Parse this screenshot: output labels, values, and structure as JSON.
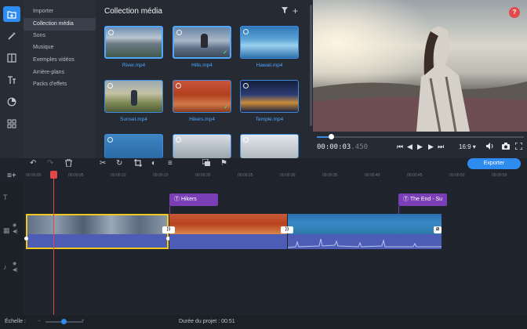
{
  "nav": {
    "items": [
      "Importer",
      "Collection média",
      "Sons",
      "Musique",
      "Exemples vidéos",
      "Arrière-plans",
      "Packs d'effets"
    ]
  },
  "media": {
    "title": "Collection média",
    "items": [
      {
        "label": "River.mp4",
        "selected": true,
        "checked": false
      },
      {
        "label": "Hills.mp4",
        "selected": true,
        "checked": true
      },
      {
        "label": "Hawaii.mp4",
        "selected": false,
        "checked": false
      },
      {
        "label": "Sunset.mp4",
        "selected": false,
        "checked": false
      },
      {
        "label": "Hikers.mp4",
        "selected": false,
        "checked": true
      },
      {
        "label": "Temple.mp4",
        "selected": false,
        "checked": false
      },
      {
        "label": "",
        "selected": false,
        "checked": false
      },
      {
        "label": "",
        "selected": false,
        "checked": false
      },
      {
        "label": "",
        "selected": false,
        "checked": false
      }
    ]
  },
  "player": {
    "timecode_main": "00:00:03",
    "timecode_ms": ".450",
    "aspect_ratio": "16:9",
    "progress": 0.07
  },
  "toolbar": {
    "export_label": "Exporter"
  },
  "ruler": {
    "ticks": [
      "00:00:00",
      "00:00:05",
      "00:00:10",
      "00:00:15",
      "00:00:20",
      "00:00:25",
      "00:00:30",
      "00:00:35",
      "00:00:40",
      "00:00:45",
      "00:00:50",
      "00:00:55"
    ]
  },
  "timeline": {
    "title_clips": [
      "Hikers",
      "The End - Su"
    ]
  },
  "footer": {
    "scale_label": "Échelle :",
    "duration_label": "Durée du projet :",
    "duration_value": "00:51"
  },
  "colors": {
    "accent": "#2e8bf0",
    "title_clip": "#7a3fb6",
    "audio_clip": "#4d5db5",
    "playhead": "#e04848",
    "help": "#e24b4b"
  }
}
